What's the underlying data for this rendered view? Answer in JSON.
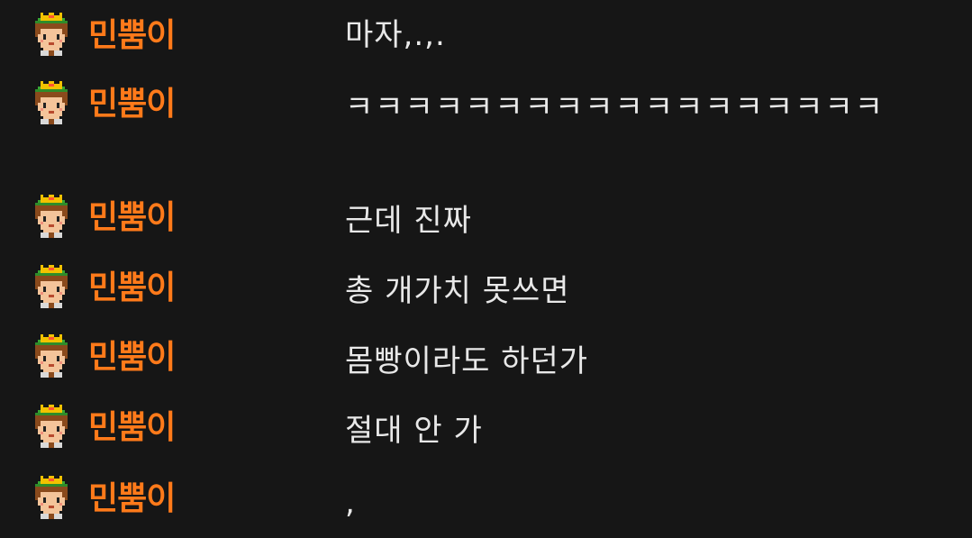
{
  "colors": {
    "background": "#161616",
    "username": "#ff7a1a",
    "message_text": "#e8e8e8"
  },
  "avatar": {
    "icon": "pixel-crowned-character-icon"
  },
  "messages": [
    {
      "user": "민뿜이",
      "text": "마자,.,."
    },
    {
      "user": "민뿜이",
      "text": "ㅋㅋㅋㅋㅋㅋㅋㅋㅋㅋㅋㅋㅋㅋㅋㅋㅋㅋ"
    },
    {
      "user": "민뿜이",
      "text": "근데 진짜"
    },
    {
      "user": "민뿜이",
      "text": "총 개가치 못쓰면"
    },
    {
      "user": "민뿜이",
      "text": "몸빵이라도 하던가"
    },
    {
      "user": "민뿜이",
      "text": "절대 안 가"
    },
    {
      "user": "민뿜이",
      "text": ","
    }
  ]
}
